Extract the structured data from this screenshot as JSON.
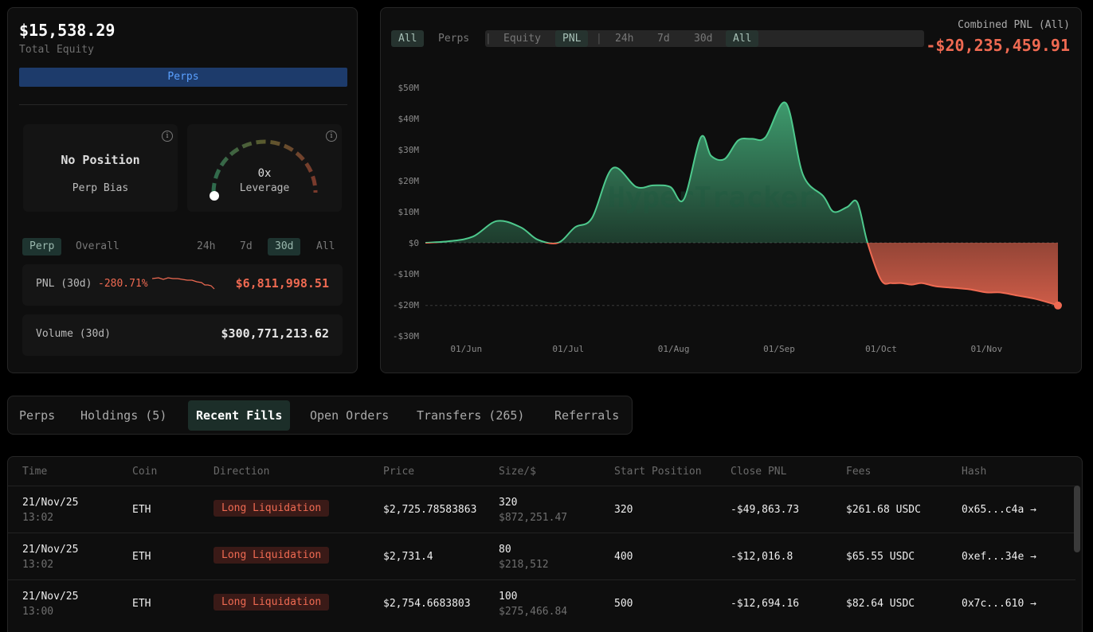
{
  "account": {
    "equity": "$15,538.29",
    "equity_label": "Total Equity",
    "perps_bar_label": "Perps"
  },
  "bias_card": {
    "title": "No Position",
    "label": "Perp Bias"
  },
  "leverage_card": {
    "value": "0x",
    "label": "Leverage",
    "level": 0
  },
  "period_tabs": {
    "scope": [
      "Perp",
      "Overall"
    ],
    "scope_selected": "Perp",
    "ranges": [
      "24h",
      "7d",
      "30d",
      "All"
    ],
    "range_selected": "30d"
  },
  "pnl_stat": {
    "label": "PNL (30d)",
    "percent": "-280.71%",
    "value": "$6,811,998.51"
  },
  "volume_stat": {
    "label": "Volume (30d)",
    "value": "$300,771,213.62"
  },
  "chart_header": {
    "tabs": [
      "All",
      "Perps",
      "|",
      "Equity",
      "PNL",
      "|",
      "24h",
      "7d",
      "30d",
      "All"
    ],
    "active": [
      0,
      4,
      9
    ],
    "combined_label": "Combined PNL (All)",
    "combined_value": "-$20,235,459.91",
    "watermark": "HyperTracker"
  },
  "chart_data": {
    "type": "area",
    "title": "",
    "xlabel": "",
    "ylabel": "",
    "x_ticks": [
      "01/Jun",
      "01/Jul",
      "01/Aug",
      "01/Sep",
      "01/Oct",
      "01/Nov"
    ],
    "y_ticks": [
      "$50M",
      "$40M",
      "$30M",
      "$20M",
      "$10M",
      "$0",
      "-$10M",
      "-$20M",
      "-$30M"
    ],
    "ylim": [
      -30,
      50
    ],
    "y_unit": "$M",
    "grid": false,
    "positive_color": "#4ec98d",
    "negative_color": "#ef6a52",
    "series": [
      {
        "x": [
          "05/20",
          "05/27",
          "06/03",
          "06/10",
          "06/17",
          "06/22",
          "06/28",
          "07/03",
          "07/08",
          "07/14",
          "07/21",
          "07/26",
          "07/31",
          "08/04",
          "08/09",
          "08/12",
          "08/16",
          "08/20",
          "08/24",
          "08/28",
          "09/03",
          "09/08",
          "09/14",
          "09/17",
          "09/21",
          "09/24",
          "09/27",
          "10/01",
          "10/04",
          "10/07",
          "10/10",
          "10/13",
          "10/17",
          "10/22",
          "10/27",
          "11/01",
          "11/05",
          "11/10",
          "11/15",
          "11/20",
          "11/22"
        ],
        "values": [
          0,
          0.5,
          2,
          7,
          5,
          1,
          0,
          5,
          8,
          24,
          18,
          18.5,
          18,
          14,
          34,
          28,
          27,
          33,
          33.5,
          34,
          45,
          22,
          15,
          10,
          11.5,
          13,
          0,
          -12,
          -13,
          -13,
          -13.5,
          -13,
          -14,
          -14.5,
          -15,
          -16,
          -16,
          -17,
          -18,
          -19.5,
          -20.2
        ]
      }
    ]
  },
  "bottom_tabs": {
    "items": [
      "Perps",
      "Holdings (5)",
      "Recent Fills",
      "Open Orders",
      "Transfers (265)",
      "Referrals"
    ],
    "active": 2
  },
  "fills_table": {
    "columns": [
      "Time",
      "Coin",
      "Direction",
      "Price",
      "Size/$",
      "Start Position",
      "Close PNL",
      "Fees",
      "Hash"
    ],
    "rows": [
      {
        "date": "21/Nov/25",
        "time": "13:02",
        "coin": "ETH",
        "direction": "Long Liquidation",
        "price": "$2,725.78583863",
        "size": "320",
        "size_usd": "$872,251.47",
        "start": "320",
        "pnl": "-$49,863.73",
        "fees": "$261.68 USDC",
        "hash": "0x65...c4a →"
      },
      {
        "date": "21/Nov/25",
        "time": "13:02",
        "coin": "ETH",
        "direction": "Long Liquidation",
        "price": "$2,731.4",
        "size": "80",
        "size_usd": "$218,512",
        "start": "400",
        "pnl": "-$12,016.8",
        "fees": "$65.55 USDC",
        "hash": "0xef...34e →"
      },
      {
        "date": "21/Nov/25",
        "time": "13:00",
        "coin": "ETH",
        "direction": "Long Liquidation",
        "price": "$2,754.6683803",
        "size": "100",
        "size_usd": "$275,466.84",
        "start": "500",
        "pnl": "-$12,694.16",
        "fees": "$82.64 USDC",
        "hash": "0x7c...610 →"
      }
    ]
  }
}
